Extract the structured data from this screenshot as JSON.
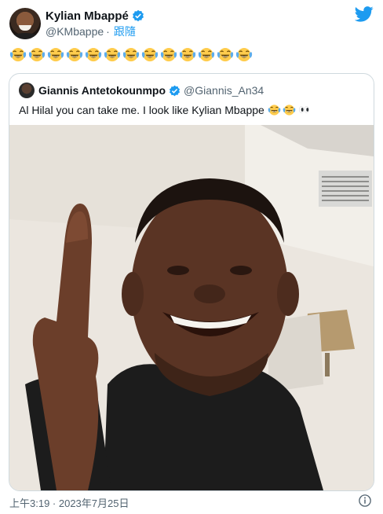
{
  "author": {
    "name": "Kylian Mbappé",
    "handle": "@KMbappe",
    "separator": "·",
    "follow_label": "跟隨"
  },
  "tweet_emoji_count": 13,
  "quoted": {
    "name": "Giannis Antetokounmpo",
    "handle": "@Giannis_An34",
    "text": "Al Hilal you can take me. I look like Kylian Mbappe",
    "trailing_emojis": [
      "face-with-tears-of-joy",
      "face-with-tears-of-joy",
      "eyes"
    ]
  },
  "timestamp": "上午3:19 · 2023年7月25日",
  "colors": {
    "verified": "#1d9bf0",
    "twitter_blue": "#1d9bf0",
    "muted": "#536471",
    "border": "#cfd9de"
  },
  "icons": [
    "verified-badge-icon",
    "twitter-bird-icon",
    "info-icon",
    "tears-of-joy-emoji",
    "eyes-emoji"
  ]
}
